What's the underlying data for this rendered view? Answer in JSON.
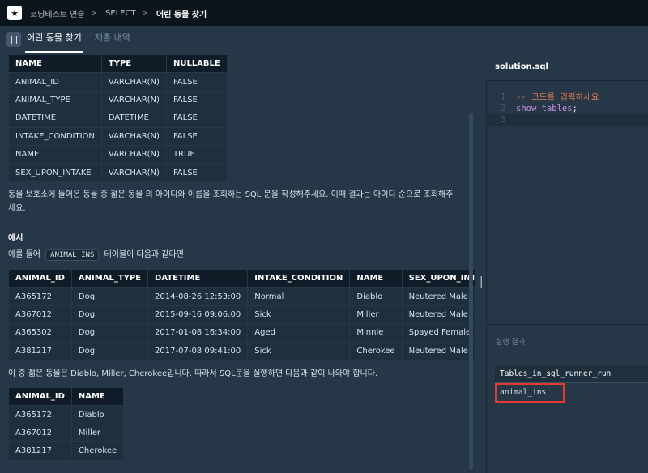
{
  "topbar": {
    "logo": "★",
    "breadcrumb": [
      "코딩테스트 연습",
      "SELECT",
      "어린 동물 찾기"
    ],
    "separator": ">"
  },
  "tabs": [
    {
      "label": "어린 동물 찾기",
      "active": true
    },
    {
      "label": "제출 내역",
      "active": false
    }
  ],
  "schema_table": {
    "headers": [
      "NAME",
      "TYPE",
      "NULLABLE"
    ],
    "rows": [
      [
        "ANIMAL_ID",
        "VARCHAR(N)",
        "FALSE"
      ],
      [
        "ANIMAL_TYPE",
        "VARCHAR(N)",
        "FALSE"
      ],
      [
        "DATETIME",
        "DATETIME",
        "FALSE"
      ],
      [
        "INTAKE_CONDITION",
        "VARCHAR(N)",
        "FALSE"
      ],
      [
        "NAME",
        "VARCHAR(N)",
        "TRUE"
      ],
      [
        "SEX_UPON_INTAKE",
        "VARCHAR(N)",
        "FALSE"
      ]
    ]
  },
  "problem": {
    "line1": "동물 보호소에 들어온 동물 중 젊은 동물 의 아이디와 이름을 조회하는 SQL 문을 작성해주세요. 이때 결과는 아이디 순으로 조회해주",
    "line2": "세요.",
    "example_heading": "예시",
    "example_prefix": "예를 들어",
    "example_code": "ANIMAL_INS",
    "example_suffix": "테이블이 다음과 같다면"
  },
  "example_table": {
    "headers": [
      "ANIMAL_ID",
      "ANIMAL_TYPE",
      "DATETIME",
      "INTAKE_CONDITION",
      "NAME",
      "SEX_UPON_INTAKE"
    ],
    "rows": [
      [
        "A365172",
        "Dog",
        "2014-08-26 12:53:00",
        "Normal",
        "Diablo",
        "Neutered Male"
      ],
      [
        "A367012",
        "Dog",
        "2015-09-16 09:06:00",
        "Sick",
        "Miller",
        "Neutered Male"
      ],
      [
        "A365302",
        "Dog",
        "2017-01-08 16:34:00",
        "Aged",
        "Minnie",
        "Spayed Female"
      ],
      [
        "A381217",
        "Dog",
        "2017-07-08 09:41:00",
        "Sick",
        "Cherokee",
        "Neutered Male"
      ]
    ]
  },
  "explain": "이 중 젊은 동물은 Diablo, Miller, Cherokee입니다. 따라서 SQL문을 실행하면 다음과 같이 나와야 합니다.",
  "answer_table": {
    "headers": [
      "ANIMAL_ID",
      "NAME"
    ],
    "rows": [
      [
        "A365172",
        "Diablo"
      ],
      [
        "A367012",
        "Miller"
      ],
      [
        "A381217",
        "Cherokee"
      ]
    ]
  },
  "editor": {
    "filename": "solution.sql",
    "lines": [
      {
        "num": "1",
        "text": "-- 코드를 입력하세요"
      },
      {
        "num": "2",
        "kw": "show tables",
        "rest": ";"
      },
      {
        "num": "3",
        "text": ""
      }
    ]
  },
  "result": {
    "label": "실행 결과",
    "header": "Tables_in_sql_runner_run",
    "rows": [
      "animal_ins"
    ],
    "highlight_color": "#e53935"
  },
  "grip": "|||"
}
